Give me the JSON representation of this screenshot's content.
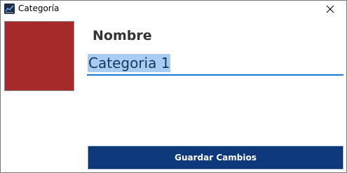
{
  "window": {
    "title": "Categoría",
    "icon": "app-chart-icon",
    "close_icon": "close-icon"
  },
  "category": {
    "color": "#a72a2a"
  },
  "form": {
    "name_label": "Nombre",
    "name_value": "Categoria 1",
    "save_label": "Guardar Cambios"
  },
  "colors": {
    "accent": "#1e78d7",
    "button": "#0e3a7c",
    "selection": "#a8cdf2"
  }
}
